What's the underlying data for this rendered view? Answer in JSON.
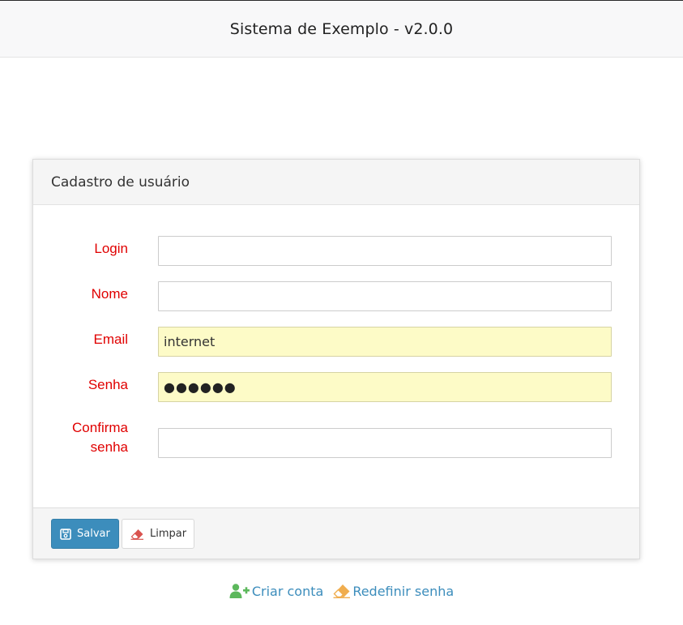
{
  "header": {
    "title": "Sistema de Exemplo - v2.0.0"
  },
  "panel": {
    "title": "Cadastro de usuário"
  },
  "form": {
    "login": {
      "label": "Login",
      "value": ""
    },
    "nome": {
      "label": "Nome",
      "value": ""
    },
    "email": {
      "label": "Email",
      "value": "internet"
    },
    "senha": {
      "label": "Senha",
      "value": "●●●●●●"
    },
    "confirma": {
      "label_line1": "Confirma",
      "label_line2": "senha",
      "value": ""
    }
  },
  "footer": {
    "save_label": "Salvar",
    "clear_label": "Limpar"
  },
  "links": {
    "create_account": "Criar conta",
    "reset_password": "Redefinir senha"
  },
  "colors": {
    "required_label": "#e00000",
    "primary": "#3c8dbc",
    "autofill": "#fdfbc7",
    "create_icon": "#5cb85c",
    "reset_icon": "#f0ad4e"
  },
  "icons": {
    "save": "floppy-disk-icon",
    "clear": "eraser-icon",
    "create": "user-plus-icon",
    "reset": "eraser-icon"
  }
}
